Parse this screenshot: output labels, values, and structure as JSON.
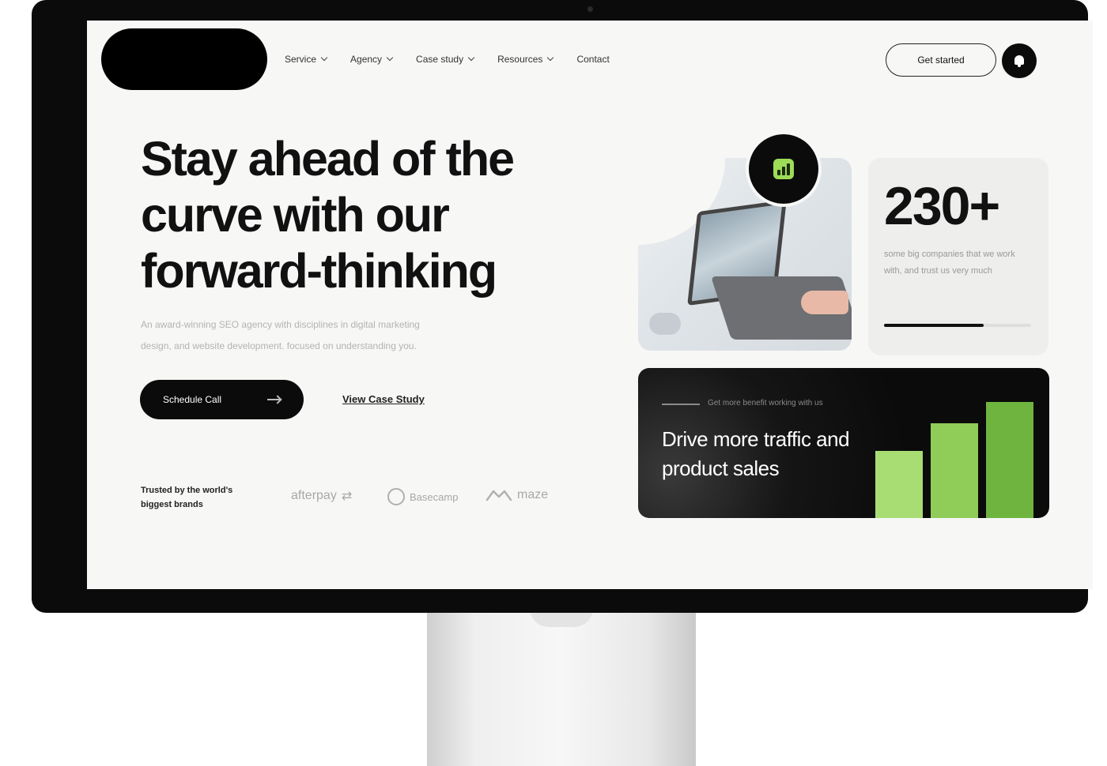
{
  "nav": {
    "items": [
      {
        "label": "Service",
        "has_dropdown": true
      },
      {
        "label": "Agency",
        "has_dropdown": true
      },
      {
        "label": "Case study",
        "has_dropdown": true
      },
      {
        "label": "Resources",
        "has_dropdown": true
      },
      {
        "label": "Contact",
        "has_dropdown": false
      }
    ],
    "cta_label": "Get started",
    "bell_icon": "bell-icon"
  },
  "hero": {
    "title_lines": [
      "Stay ahead of the",
      "curve with our",
      "forward-thinking"
    ],
    "subtitle_lines": [
      "An award-winning SEO agency with disciplines in digital marketing",
      "design, and website development. focused on understanding you."
    ],
    "primary_button": "Schedule Call",
    "secondary_link": "View Case Study"
  },
  "trusted": {
    "label": "Trusted by the world's biggest brands",
    "brands": [
      "afterpay",
      "Basecamp",
      "maze"
    ]
  },
  "stat": {
    "value": "230+",
    "description": "some big companies that we work with, and trust us very much",
    "progress": 0.68
  },
  "promo": {
    "kicker": "Get more benefit working with us",
    "title": "Drive more traffic and product sales",
    "bar_levels": [
      0.53,
      0.75,
      0.92
    ],
    "bar_colors": [
      "#a8dd73",
      "#8fcc58",
      "#6fb43f"
    ]
  },
  "colors": {
    "accent_green": "#9edb57",
    "dark": "#0b0b0b",
    "screen_bg": "#f7f7f6"
  }
}
